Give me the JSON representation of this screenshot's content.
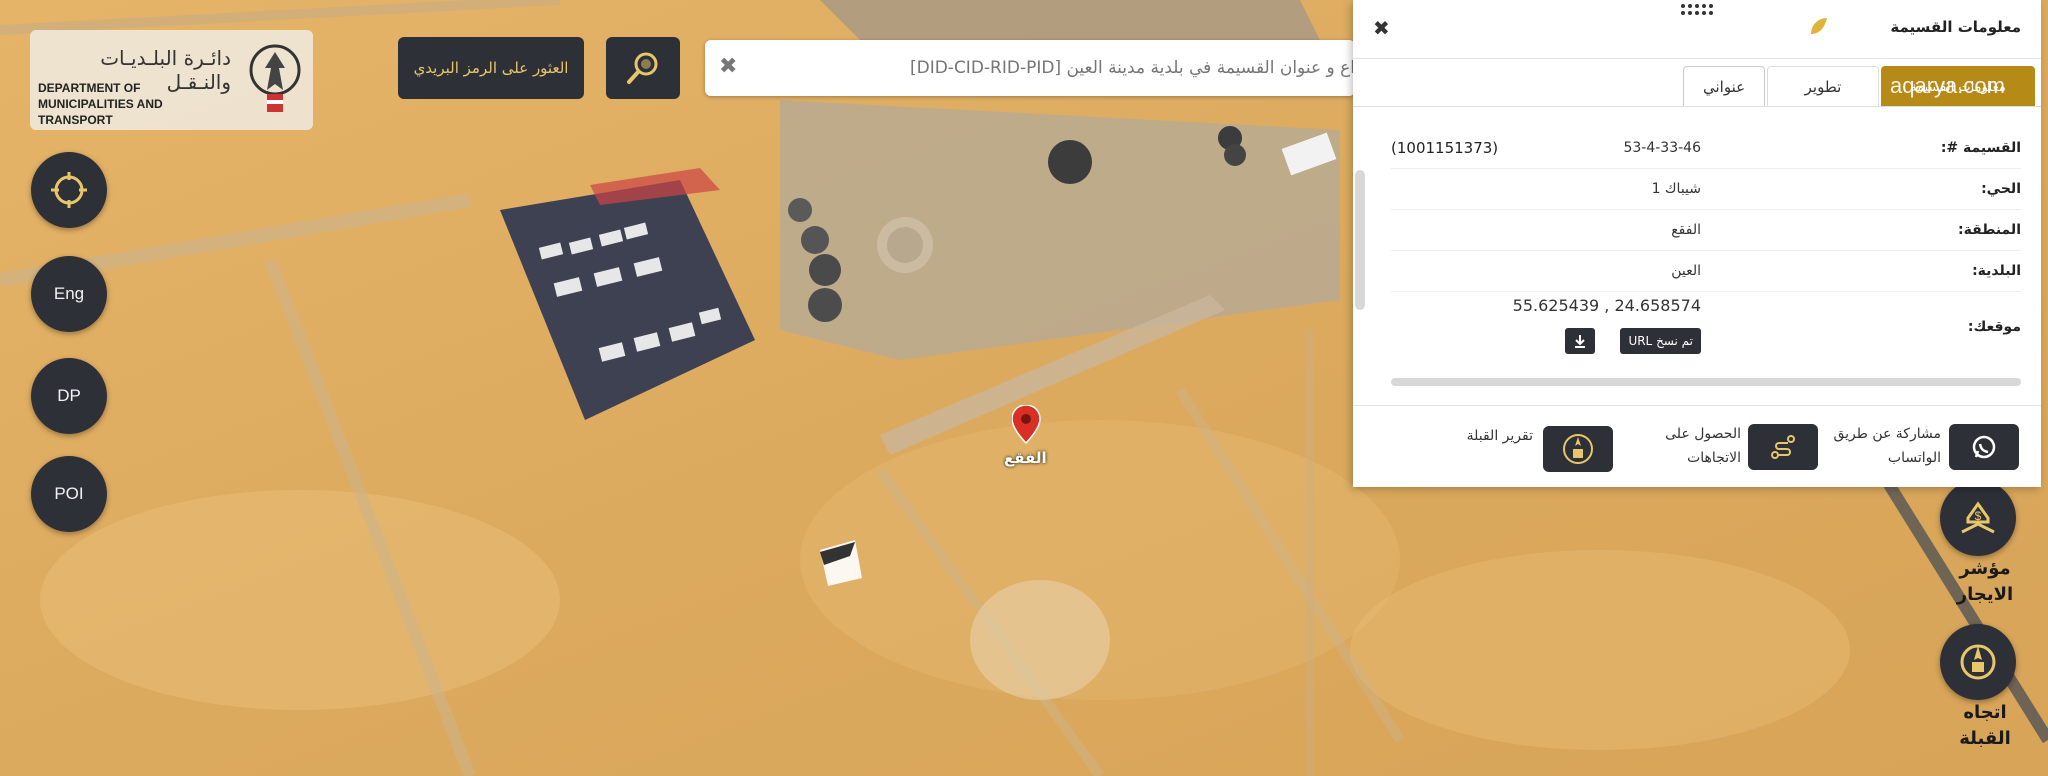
{
  "header": {
    "logo_ar": "دائـرة البلـديـات والنـقـل",
    "logo_en": "DEPARTMENT OF MUNICIPALITIES AND TRANSPORT",
    "find_postal_label": "العثور على الرمز البريدي",
    "search_placeholder": "اع و عنوان القسيمة في بلدية مدينة العين [DID-CID-RID-PID]",
    "search_icon": "magnifier-icon",
    "clear_icon": "close-icon"
  },
  "left_controls": {
    "locate_icon": "crosshair-icon",
    "lang_label": "Eng",
    "dp_label": "DP",
    "poi_label": "POI"
  },
  "map": {
    "marker_label": "الفقع",
    "marker_icon": "map-pin-icon"
  },
  "panel": {
    "title": "معلومات القسيمة",
    "close_icon": "close-icon",
    "tabs": [
      {
        "label": "عنواني",
        "active": true
      },
      {
        "label": "تطوير"
      },
      {
        "label": "معلومات القسيمة"
      }
    ],
    "watermark": "aqarya.com",
    "rows": [
      {
        "label": "القسيمة #:",
        "value": "53-4-33-46",
        "extra": "(1001151373)"
      },
      {
        "label": "الحي:",
        "value": "شيباك 1"
      },
      {
        "label": "المنطقة:",
        "value": "الفقع"
      },
      {
        "label": "البلدية:",
        "value": "العين"
      },
      {
        "label": "موقعك:",
        "value": "24.658574 , 55.625439",
        "button": "تم نسخ URL",
        "download_icon": "download-icon"
      }
    ],
    "actions": [
      {
        "label": "مشاركة عن طريق الواتساب",
        "icon": "whatsapp-icon"
      },
      {
        "label": "الحصول على الاتجاهات",
        "icon": "route-icon"
      },
      {
        "label": "تقرير القبلة",
        "icon": "qibla-report-icon"
      }
    ]
  },
  "right_controls": [
    {
      "label": "مؤشر الايجار",
      "icon": "rent-index-icon"
    },
    {
      "label": "اتجاه القبلة",
      "icon": "qibla-compass-icon"
    }
  ],
  "colors": {
    "sand": "#dfb060",
    "dark_button": "#2e3038",
    "gold": "#e8c76a",
    "marker_red": "#d93025",
    "watermark_gold": "#b58a16"
  }
}
